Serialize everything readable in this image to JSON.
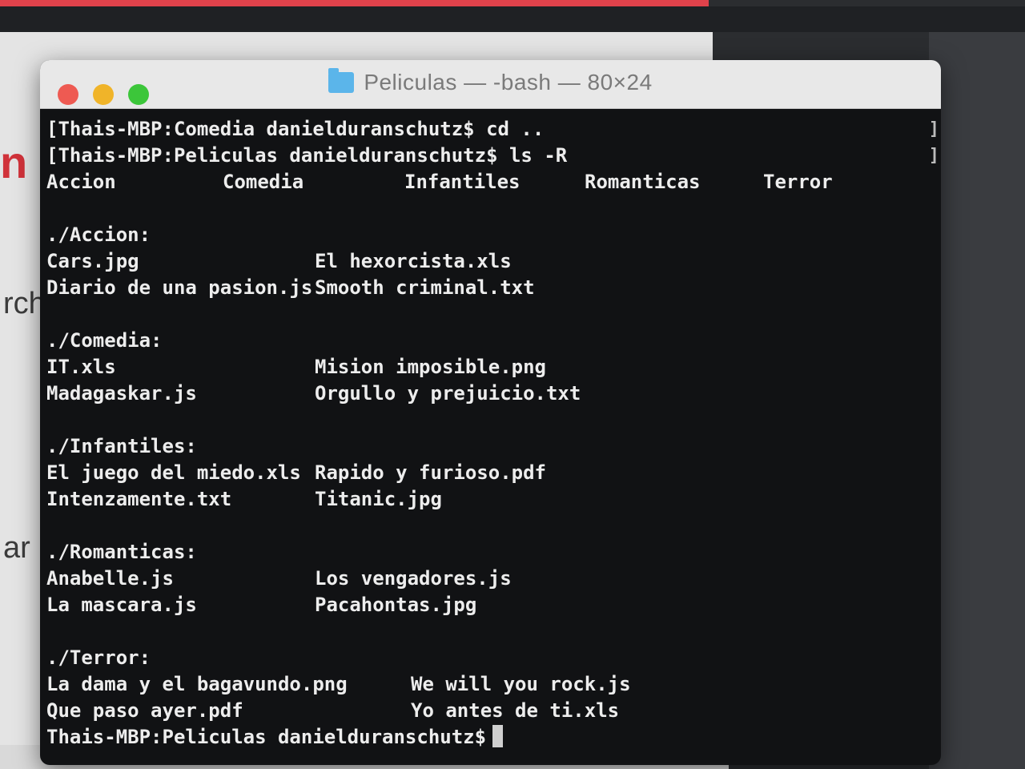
{
  "background": {
    "red_fragment": "n (",
    "text_fragment_1": "rch",
    "text_fragment_2": "ar"
  },
  "window": {
    "title_folder": "Peliculas",
    "title_rest": "— -bash — 80×24"
  },
  "terminal": {
    "cmd1": "[Thais-MBP:Comedia danielduranschutz$ cd ..",
    "cmd2": "[Thais-MBP:Peliculas danielduranschutz$ ls -R",
    "top_dirs": [
      "Accion",
      "Comedia",
      "Infantiles",
      "Romanticas",
      "Terror"
    ],
    "sections": [
      {
        "header": "./Accion:",
        "rows": [
          [
            "Cars.jpg",
            "El hexorcista.xls"
          ],
          [
            "Diario de una pasion.js",
            "Smooth criminal.txt"
          ]
        ]
      },
      {
        "header": "./Comedia:",
        "rows": [
          [
            "IT.xls",
            "Mision imposible.png"
          ],
          [
            "Madagaskar.js",
            "Orgullo y prejuicio.txt"
          ]
        ]
      },
      {
        "header": "./Infantiles:",
        "rows": [
          [
            "El juego del miedo.xls",
            "Rapido y furioso.pdf"
          ],
          [
            "Intenzamente.txt",
            "Titanic.jpg"
          ]
        ]
      },
      {
        "header": "./Romanticas:",
        "rows": [
          [
            "Anabelle.js",
            "Los vengadores.js"
          ],
          [
            "La mascara.js",
            "Pacahontas.jpg"
          ]
        ]
      },
      {
        "header": "./Terror:",
        "rows": [
          [
            "La dama y el bagavundo.png",
            "We will you rock.js"
          ],
          [
            "Que paso ayer.pdf",
            "Yo antes de ti.xls"
          ]
        ]
      }
    ],
    "prompt": "Thais-MBP:Peliculas danielduranschutz$",
    "edge_bracket": "]"
  }
}
